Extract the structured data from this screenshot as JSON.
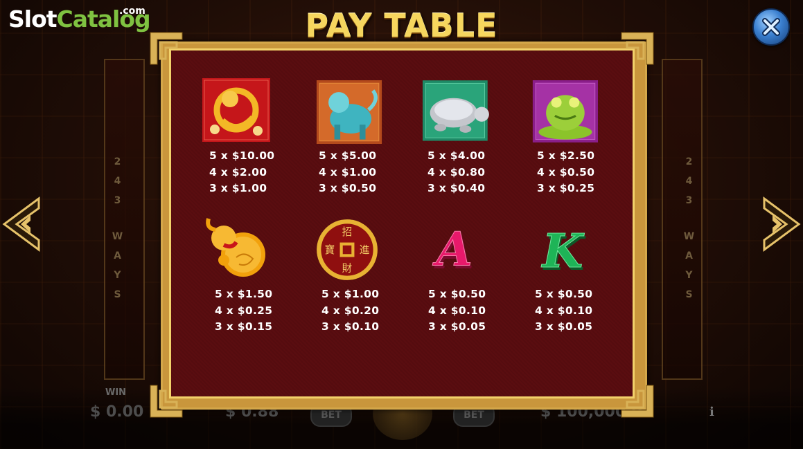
{
  "watermark": {
    "slot": "Slot",
    "catalog": "Catalog",
    "com": ".com"
  },
  "title": "PAY TABLE",
  "background": {
    "ways_letters": [
      "2",
      "4",
      "3",
      "W",
      "A",
      "Y",
      "S"
    ],
    "win_label": "WIN",
    "win_value": "$ 0.00",
    "bet_value": "$ 0.88",
    "balance_value": "$ 100,000.0",
    "bet_minus_label": "BET",
    "bet_plus_label": "BET",
    "info_label": "i"
  },
  "symbols": [
    {
      "icon": "dragon-icon",
      "color": "#c5161a",
      "pays": [
        "5 x $10.00",
        "4 x $2.00",
        "3 x $1.00"
      ]
    },
    {
      "icon": "qilin-icon",
      "color": "#b44a1c",
      "pays": [
        "5 x $5.00",
        "4 x $1.00",
        "3 x $0.50"
      ]
    },
    {
      "icon": "turtle-icon",
      "color": "#1e8a66",
      "pays": [
        "5 x $4.00",
        "4 x $0.80",
        "3 x $0.40"
      ]
    },
    {
      "icon": "toad-icon",
      "color": "#8a1e8a",
      "pays": [
        "5 x $2.50",
        "4 x $0.50",
        "3 x $0.25"
      ]
    },
    {
      "icon": "gourd-icon",
      "color": "#f2a10c",
      "pays": [
        "5 x $1.50",
        "4 x $0.25",
        "3 x $0.15"
      ]
    },
    {
      "icon": "coin-icon",
      "color": "#8f0f0f",
      "pays": [
        "5 x $1.00",
        "4 x $0.20",
        "3 x $0.10"
      ],
      "chars": [
        "招",
        "進",
        "財",
        "寶"
      ]
    },
    {
      "icon": "letter-a-icon",
      "color": "#e8196b",
      "letter": "A",
      "pays": [
        "5 x $0.50",
        "4 x $0.10",
        "3 x $0.05"
      ]
    },
    {
      "icon": "letter-k-icon",
      "color": "#1eb457",
      "letter": "K",
      "pays": [
        "5 x $0.50",
        "4 x $0.10",
        "3 x $0.05"
      ]
    }
  ],
  "colors": {
    "title_gold": "#f6d65e",
    "panel_bg": "#5a0d10",
    "frame_gold": "#d4a74a",
    "logo_green": "#7fc241"
  }
}
